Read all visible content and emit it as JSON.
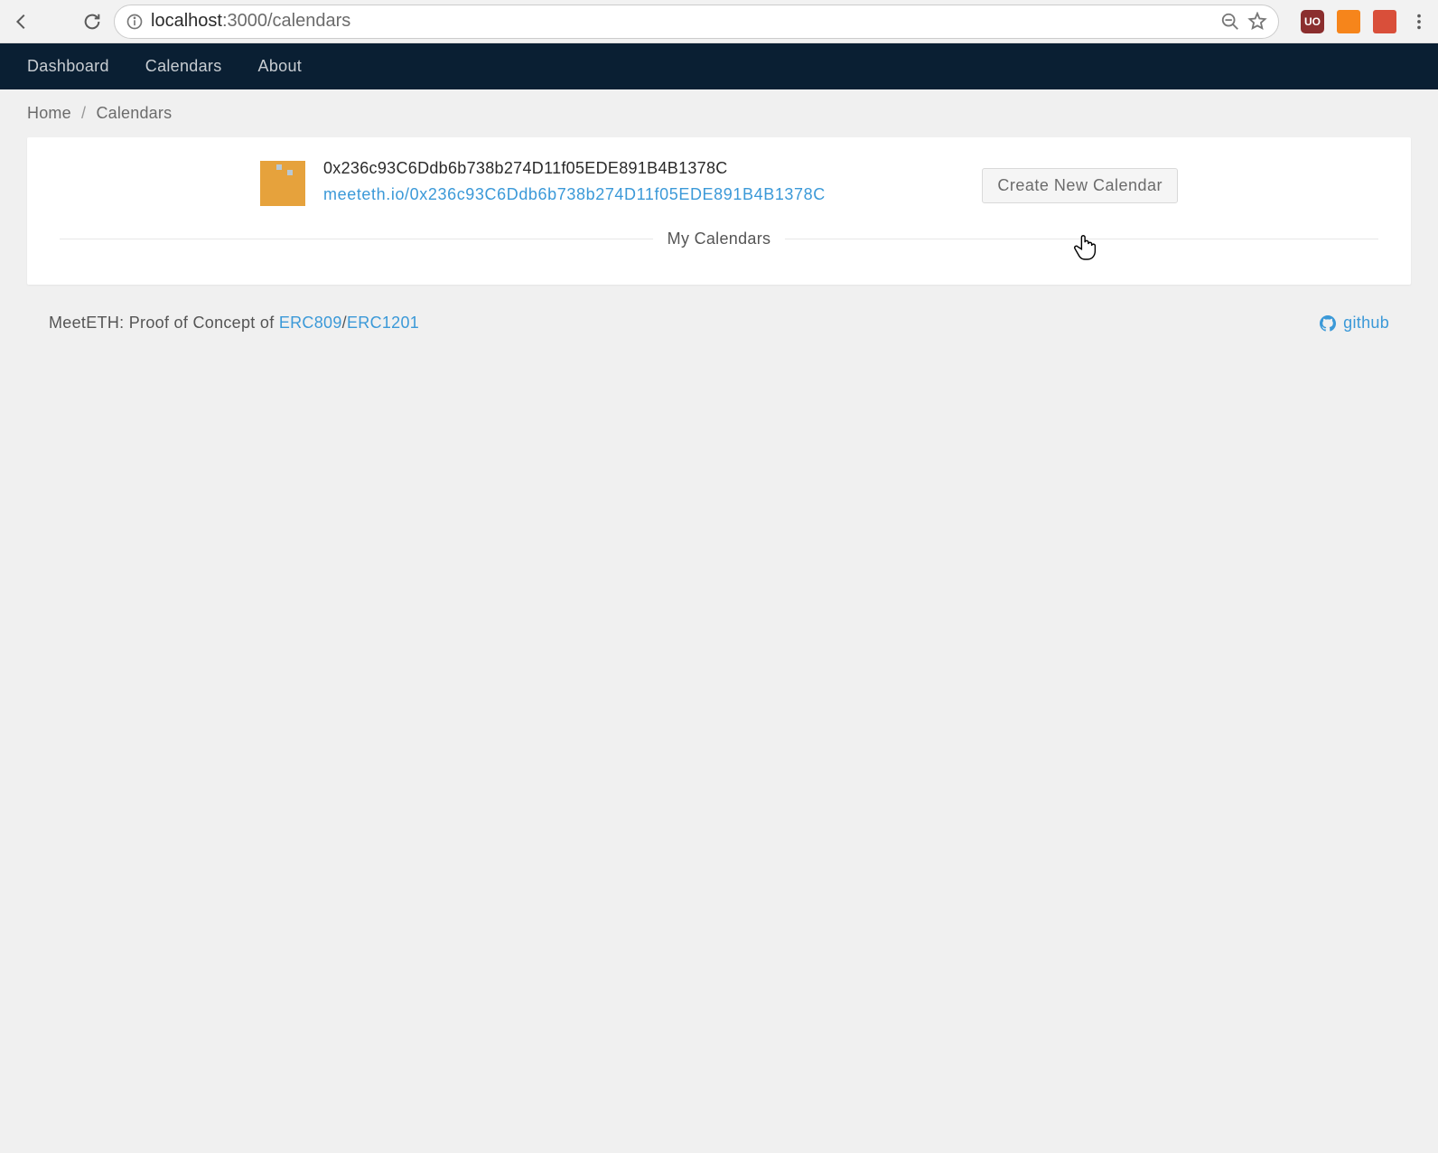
{
  "browser": {
    "url_host": "localhost",
    "url_port_path": ":3000/calendars"
  },
  "nav": {
    "items": [
      "Dashboard",
      "Calendars",
      "About"
    ]
  },
  "breadcrumb": {
    "home": "Home",
    "sep": "/",
    "current": "Calendars"
  },
  "profile": {
    "address": "0x236c93C6Ddb6b738b274D11f05EDE891B4B1378C",
    "link": "meeteth.io/0x236c93C6Ddb6b738b274D11f05EDE891B4B1378C",
    "create_btn": "Create New Calendar"
  },
  "section": {
    "my_calendars": "My Calendars"
  },
  "footer": {
    "prefix": "MeetETH: Proof of Concept of ",
    "erc809": "ERC809",
    "slash": "/",
    "erc1201": "ERC1201",
    "github": "github"
  }
}
